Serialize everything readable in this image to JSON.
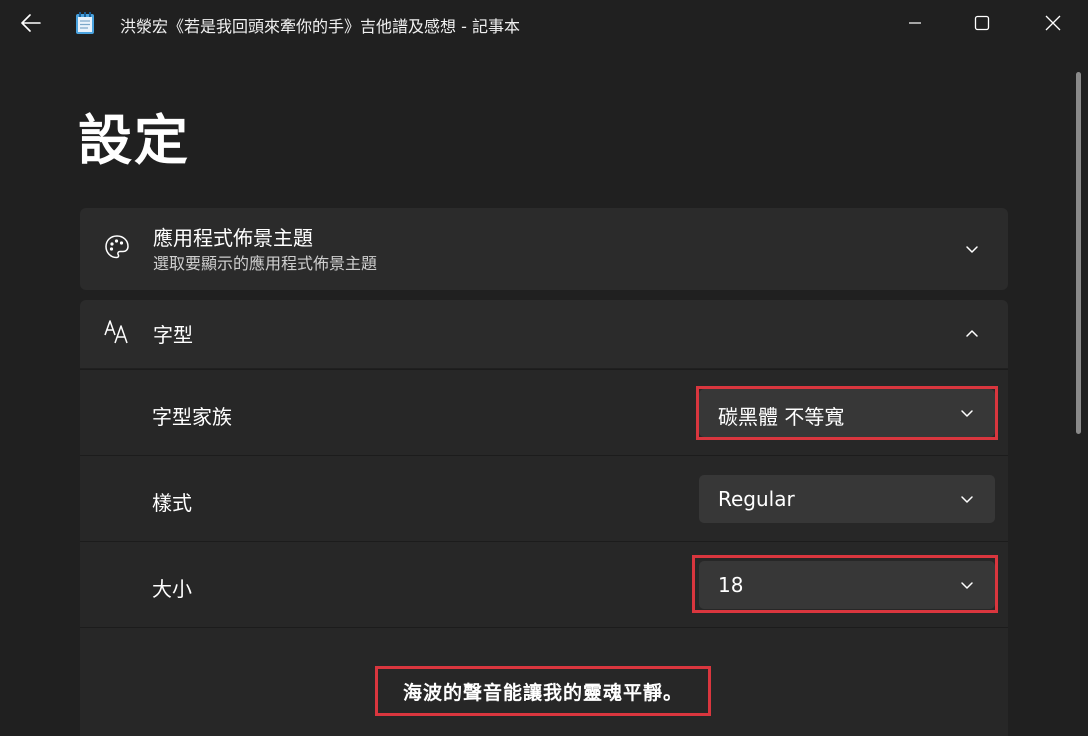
{
  "window": {
    "title": "洪滎宏《若是我回頭來牽你的手》吉他譜及感想 - 記事本",
    "icons": {
      "back": "arrow-left-icon",
      "app": "notepad-icon",
      "minimize": "minimize-icon",
      "maximize": "maximize-icon",
      "close": "close-icon"
    }
  },
  "page": {
    "title": "設定"
  },
  "theme_card": {
    "title": "應用程式佈景主題",
    "subtitle": "選取要顯示的應用程式佈景主題",
    "icon": "palette-icon"
  },
  "font_card": {
    "title": "字型",
    "icon": "font-icon",
    "family": {
      "label": "字型家族",
      "value": "碳黑體 不等寬"
    },
    "style": {
      "label": "樣式",
      "value": "Regular"
    },
    "size": {
      "label": "大小",
      "value": "18"
    },
    "preview_text": "海波的聲音能讓我的靈魂平靜。"
  },
  "colors": {
    "background": "#202020",
    "card": "#2b2b2b",
    "dropdown": "#373737",
    "highlight": "#d9363e"
  }
}
